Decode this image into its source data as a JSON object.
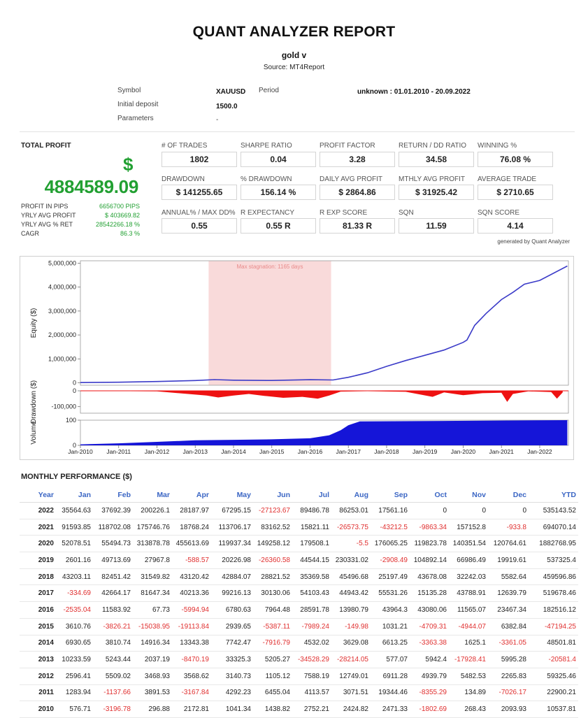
{
  "report": {
    "title": "QUANT ANALYZER REPORT",
    "strategy": "gold v",
    "source": "Source: MT4Report"
  },
  "meta": {
    "symbol_label": "Symbol",
    "symbol_value": "XAUUSD",
    "period_label": "Period",
    "period_value": "unknown : 01.01.2010 - 20.09.2022",
    "deposit_label": "Initial deposit",
    "deposit_value": "1500.0",
    "params_label": "Parameters",
    "params_value": "-"
  },
  "total_profit": {
    "label": "TOTAL PROFIT",
    "currency": "$",
    "value": "4884589.09",
    "rows": [
      {
        "label": "PROFIT IN PIPS",
        "value": "6656700 PIPS"
      },
      {
        "label": "YRLY AVG PROFIT",
        "value": "$ 403669.82"
      },
      {
        "label": "YRLY AVG % RET",
        "value": "28542266.18 %"
      },
      {
        "label": "CAGR",
        "value": "86.3 %"
      }
    ]
  },
  "stats": [
    [
      {
        "label": "# OF TRADES",
        "value": "1802"
      },
      {
        "label": "SHARPE RATIO",
        "value": "0.04"
      },
      {
        "label": "PROFIT FACTOR",
        "value": "3.28"
      },
      {
        "label": "RETURN / DD RATIO",
        "value": "34.58"
      },
      {
        "label": "WINNING %",
        "value": "76.08 %"
      }
    ],
    [
      {
        "label": "DRAWDOWN",
        "value": "$ 141255.65"
      },
      {
        "label": "% DRAWDOWN",
        "value": "156.14 %"
      },
      {
        "label": "DAILY AVG PROFIT",
        "value": "$ 2864.86"
      },
      {
        "label": "MTHLY AVG PROFIT",
        "value": "$ 31925.42"
      },
      {
        "label": "AVERAGE TRADE",
        "value": "$ 2710.65"
      }
    ],
    [
      {
        "label": "ANNUAL% / MAX DD%",
        "value": "0.55"
      },
      {
        "label": "R EXPECTANCY",
        "value": "0.55 R"
      },
      {
        "label": "R EXP SCORE",
        "value": "81.33 R"
      },
      {
        "label": "SQN",
        "value": "11.59"
      },
      {
        "label": "SQN SCORE",
        "value": "4.14"
      }
    ]
  ],
  "generated_by": "generated by Quant Analyzer",
  "chart_data": {
    "type": "line",
    "equity": {
      "ylabel": "Equity ($)",
      "yticks": [
        "5,000,000",
        "4,000,000",
        "3,000,000",
        "2,000,000",
        "1,000,000",
        "0"
      ],
      "ylim": [
        -100000,
        5100000
      ],
      "x": [
        2010.0,
        2011.0,
        2012.0,
        2013.0,
        2013.5,
        2014.0,
        2015.0,
        2016.0,
        2016.6,
        2017.0,
        2017.5,
        2018.0,
        2018.5,
        2019.0,
        2019.5,
        2020.0,
        2020.1,
        2020.3,
        2020.6,
        2021.0,
        2021.3,
        2021.6,
        2022.0,
        2022.72
      ],
      "y": [
        12000,
        25000,
        55000,
        95000,
        135000,
        110000,
        100000,
        130000,
        120000,
        230000,
        420000,
        690000,
        930000,
        1150000,
        1370000,
        1690000,
        1790000,
        2400000,
        2900000,
        3480000,
        3780000,
        4120000,
        4280000,
        4880000
      ],
      "annotation": "Max stagnation: 1165 days",
      "stagnation_x": [
        2013.35,
        2016.55
      ]
    },
    "drawdown": {
      "ylabel": "Drawdown ($)",
      "yticks": [
        "0",
        "-100,000"
      ],
      "ylim": [
        -141256,
        0
      ],
      "x": [
        2010.0,
        2012.0,
        2013.3,
        2013.6,
        2014.0,
        2014.4,
        2014.8,
        2015.3,
        2015.8,
        2016.2,
        2016.5,
        2016.8,
        2017.5,
        2018.5,
        2019.2,
        2019.5,
        2020.0,
        2020.5,
        2021.0,
        2021.15,
        2021.3,
        2021.7,
        2022.3,
        2022.45,
        2022.6
      ],
      "y": [
        0,
        -3000,
        -30000,
        -42000,
        -30000,
        -20000,
        -32000,
        -44000,
        -38000,
        -50000,
        -30000,
        -5000,
        -2000,
        -6000,
        -38000,
        -10000,
        -28000,
        -15000,
        -12000,
        -70000,
        -20000,
        -3000,
        -8000,
        -50000,
        -10000
      ]
    },
    "volume": {
      "ylabel": "Volume",
      "yticks": [
        "100",
        "0"
      ],
      "ylim": [
        0,
        100
      ],
      "x": [
        2010.0,
        2011.0,
        2012.0,
        2013.0,
        2014.0,
        2015.0,
        2016.0,
        2016.5,
        2016.8,
        2017.0,
        2017.3,
        2022.72
      ],
      "y": [
        4,
        8,
        14,
        20,
        22,
        24,
        28,
        40,
        60,
        80,
        95,
        100
      ]
    },
    "xticks": [
      "Jan-2010",
      "Jan-2011",
      "Jan-2012",
      "Jan-2013",
      "Jan-2014",
      "Jan-2015",
      "Jan-2016",
      "Jan-2017",
      "Jan-2018",
      "Jan-2019",
      "Jan-2020",
      "Jan-2021",
      "Jan-2022"
    ],
    "xlim": [
      2010.0,
      2022.75
    ],
    "colors": {
      "equity": "#3b3bc8",
      "drawdown": "#ee1111",
      "volume": "#1515d8",
      "stagnation": "#f9dada"
    }
  },
  "monthly": {
    "title": "MONTHLY PERFORMANCE ($)",
    "headers": [
      "Year",
      "Jan",
      "Feb",
      "Mar",
      "Apr",
      "May",
      "Jun",
      "Jul",
      "Aug",
      "Sep",
      "Oct",
      "Nov",
      "Dec",
      "YTD"
    ],
    "rows": [
      [
        "2022",
        "35564.63",
        "37692.39",
        "200226.1",
        "28187.97",
        "67295.15",
        "-27123.67",
        "89486.78",
        "86253.01",
        "17561.16",
        "0",
        "0",
        "0",
        "535143.52"
      ],
      [
        "2021",
        "91593.85",
        "118702.08",
        "175746.76",
        "18768.24",
        "113706.17",
        "83162.52",
        "15821.11",
        "-26573.75",
        "-43212.5",
        "-9863.34",
        "157152.8",
        "-933.8",
        "694070.14"
      ],
      [
        "2020",
        "52078.51",
        "55494.73",
        "313878.78",
        "455613.69",
        "119937.34",
        "149258.12",
        "179508.1",
        "-5.5",
        "176065.25",
        "119823.78",
        "140351.54",
        "120764.61",
        "1882768.95"
      ],
      [
        "2019",
        "2601.16",
        "49713.69",
        "27967.8",
        "-588.57",
        "20226.98",
        "-26360.58",
        "44544.15",
        "230331.02",
        "-2908.49",
        "104892.14",
        "66986.49",
        "19919.61",
        "537325.4"
      ],
      [
        "2018",
        "43203.11",
        "82451.42",
        "31549.82",
        "43120.42",
        "42884.07",
        "28821.52",
        "35369.58",
        "45496.68",
        "25197.49",
        "43678.08",
        "32242.03",
        "5582.64",
        "459596.86"
      ],
      [
        "2017",
        "-334.69",
        "42664.17",
        "81647.34",
        "40213.36",
        "99216.13",
        "30130.06",
        "54103.43",
        "44943.42",
        "55531.26",
        "15135.28",
        "43788.91",
        "12639.79",
        "519678.46"
      ],
      [
        "2016",
        "-2535.04",
        "11583.92",
        "67.73",
        "-5994.94",
        "6780.63",
        "7964.48",
        "28591.78",
        "13980.79",
        "43964.3",
        "43080.06",
        "11565.07",
        "23467.34",
        "182516.12"
      ],
      [
        "2015",
        "3610.76",
        "-3826.21",
        "-15038.95",
        "-19113.84",
        "2939.65",
        "-5387.11",
        "-7989.24",
        "-149.98",
        "1031.21",
        "-4709.31",
        "-4944.07",
        "6382.84",
        "-47194.25"
      ],
      [
        "2014",
        "6930.65",
        "3810.74",
        "14916.34",
        "13343.38",
        "7742.47",
        "-7916.79",
        "4532.02",
        "3629.08",
        "6613.25",
        "-3363.38",
        "1625.1",
        "-3361.05",
        "48501.81"
      ],
      [
        "2013",
        "10233.59",
        "5243.44",
        "2037.19",
        "-8470.19",
        "33325.3",
        "5205.27",
        "-34528.29",
        "-28214.05",
        "577.07",
        "5942.4",
        "-17928.41",
        "5995.28",
        "-20581.4"
      ],
      [
        "2012",
        "2596.41",
        "5509.02",
        "3468.93",
        "3568.62",
        "3140.73",
        "1105.12",
        "7588.19",
        "12749.01",
        "6911.28",
        "4939.79",
        "5482.53",
        "2265.83",
        "59325.46"
      ],
      [
        "2011",
        "1283.94",
        "-1137.66",
        "3891.53",
        "-3167.84",
        "4292.23",
        "6455.04",
        "4113.57",
        "3071.51",
        "19344.46",
        "-8355.29",
        "134.89",
        "-7026.17",
        "22900.21"
      ],
      [
        "2010",
        "576.71",
        "-3196.78",
        "296.88",
        "2172.81",
        "1041.34",
        "1438.82",
        "2752.21",
        "2424.82",
        "2471.33",
        "-1802.69",
        "268.43",
        "2093.93",
        "10537.81"
      ]
    ]
  }
}
